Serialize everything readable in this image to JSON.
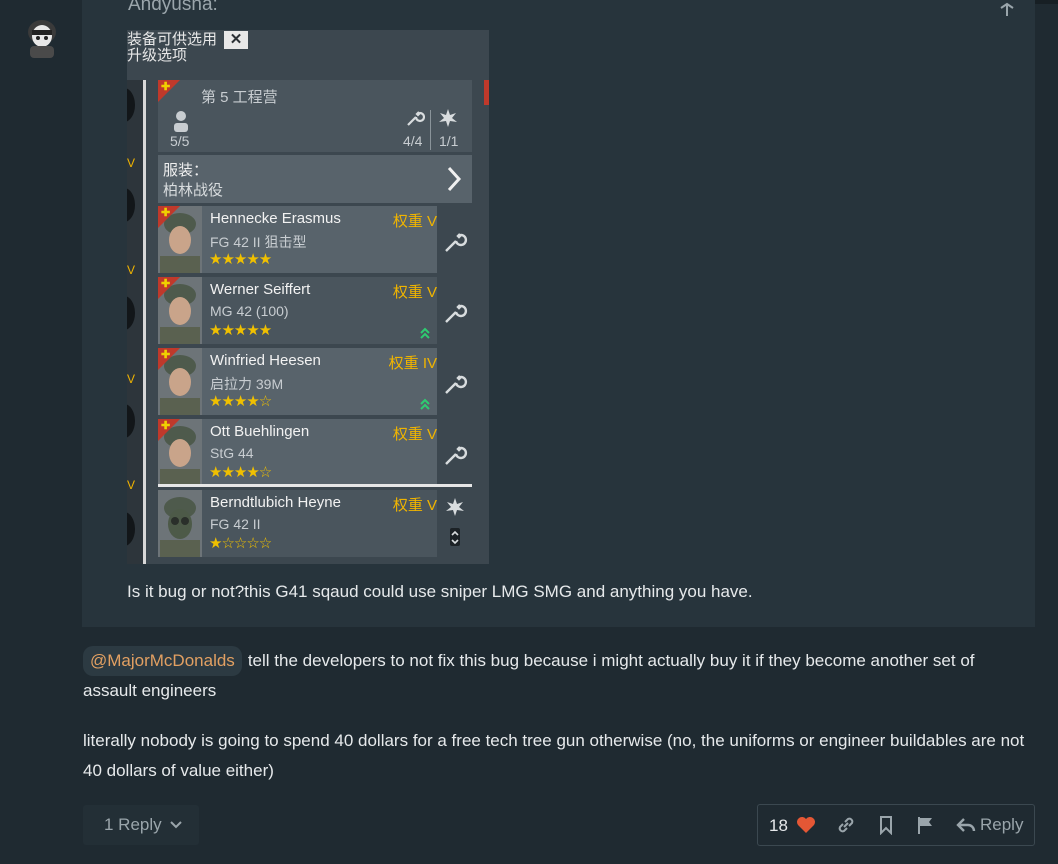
{
  "quote": {
    "author": "Andyusha:",
    "text": "Is it bug or not?this G41 sqaud could use sniper LMG SMG and anything you have."
  },
  "game": {
    "header_line1": "装备可供选用",
    "header_line2": "升级选项",
    "close_label": "✕",
    "squad": {
      "name": "第 5 工程营",
      "members": "5/5",
      "tools": "4/4",
      "exp": "1/1"
    },
    "outfit": {
      "label": "服装：",
      "value": "柏林战役"
    },
    "soldiers": [
      {
        "name": "Hennecke Erasmus",
        "weapon": "FG 42 II 狙击型",
        "rank": "权重 V",
        "stars": "★★★★★"
      },
      {
        "name": "Werner Seiffert",
        "weapon": "MG 42 (100)",
        "rank": "权重 V",
        "stars": "★★★★★"
      },
      {
        "name": "Winfried Heesen",
        "weapon": "启拉力 39M",
        "rank": "权重 IV",
        "stars": "★★★★☆"
      },
      {
        "name": "Ott Buehlingen",
        "weapon": "StG 44",
        "rank": "权重 V",
        "stars": "★★★★☆"
      },
      {
        "name": "Berndtlubich Heyne",
        "weapon": "FG 42 II",
        "rank": "权重 V",
        "stars": "★☆☆☆☆"
      }
    ]
  },
  "post": {
    "mention": "@MajorMcDonalds",
    "paragraph1": "tell the developers to not fix this bug because i might actually buy it if they become another set of assault engineers",
    "paragraph2": "literally nobody is going to spend 40 dollars for a free tech tree gun otherwise (no, the uniforms or engineer buildables are not 40 dollars of value either)"
  },
  "controls": {
    "replies_label": "1 Reply",
    "like_count": "18",
    "reply_label": "Reply"
  },
  "colors": {
    "background": "#1f2a31",
    "quote_bg": "#27343c",
    "mention": "#e2a062",
    "like_heart": "#e45735",
    "rank_gold": "#f0b400"
  }
}
